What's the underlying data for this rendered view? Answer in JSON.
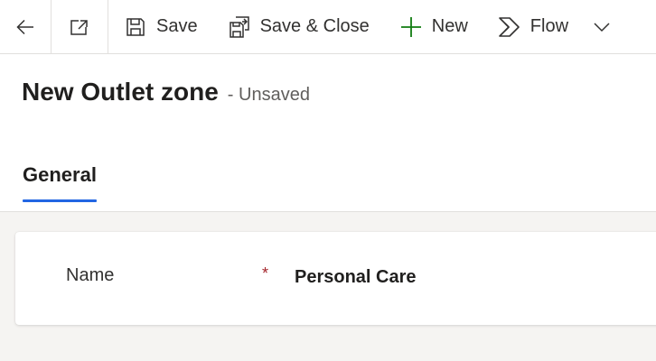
{
  "command_bar": {
    "back_icon": "arrow-left-icon",
    "popout_icon": "open-in-new-window-icon",
    "save_label": "Save",
    "save_icon": "floppy-disk-icon",
    "save_close_label": "Save & Close",
    "save_close_icon": "save-and-close-icon",
    "new_label": "New",
    "new_icon": "plus-icon",
    "flow_label": "Flow",
    "flow_icon": "flow-icon",
    "more_icon": "chevron-down-icon"
  },
  "header": {
    "title": "New Outlet zone",
    "status": "- Unsaved"
  },
  "tabs": [
    {
      "label": "General",
      "selected": true
    }
  ],
  "form": {
    "fields": [
      {
        "label": "Name",
        "required": true,
        "required_marker": "*",
        "value": "Personal Care"
      }
    ]
  },
  "colors": {
    "accent": "#2266e3",
    "new_icon": "#107c10",
    "required": "#a4262c",
    "background": "#f5f4f2"
  }
}
